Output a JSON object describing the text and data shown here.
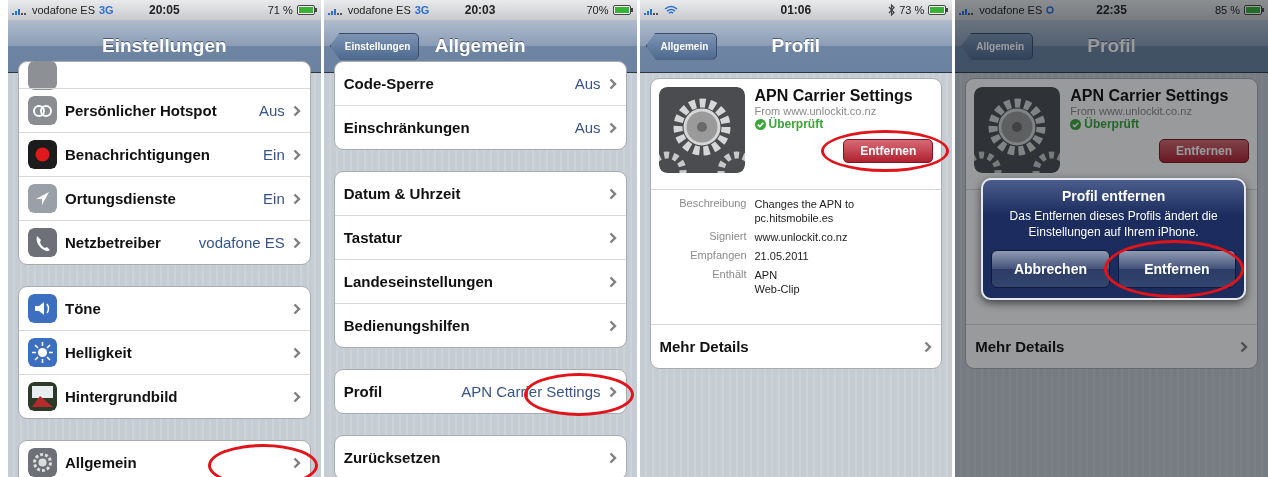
{
  "panels": [
    {
      "kind": "settings_list",
      "status_bar": {
        "carrier": "vodafone ES",
        "network": "3G",
        "time": "20:05",
        "battery": "71 %"
      },
      "nav_bar": {
        "title": "Einstellungen"
      },
      "groups": [
        {
          "cut_top": true,
          "rows": [
            {
              "kind": "partial"
            },
            {
              "kind": "icon_item",
              "label": "Persönlicher Hotspot",
              "value": "Aus"
            },
            {
              "kind": "icon_item",
              "label": "Benachrichtigungen",
              "value": "Ein"
            },
            {
              "kind": "icon_item",
              "label": "Ortungsdienste",
              "value": "Ein"
            },
            {
              "kind": "icon_item",
              "label": "Netzbetreiber",
              "value": "vodafone ES"
            }
          ]
        },
        {
          "rows": [
            {
              "kind": "icon_item",
              "label": "Töne"
            },
            {
              "kind": "icon_item",
              "label": "Helligkeit"
            },
            {
              "kind": "icon_item",
              "label": "Hintergrundbild"
            }
          ]
        },
        {
          "rows": [
            {
              "kind": "icon_item",
              "label": "Allgemein",
              "circled": true
            }
          ]
        }
      ]
    },
    {
      "kind": "settings_list",
      "status_bar": {
        "carrier": "vodafone ES",
        "network": "3G",
        "time": "20:03",
        "battery": "70%"
      },
      "nav_bar": {
        "back": "Einstellungen",
        "title": "Allgemein"
      },
      "groups": [
        {
          "cut_top": true,
          "rows": [
            {
              "kind": "item",
              "label": "Code-Sperre",
              "value": "Aus"
            },
            {
              "kind": "item",
              "label": "Einschränkungen",
              "value": "Aus"
            }
          ]
        },
        {
          "rows": [
            {
              "kind": "item",
              "label": "Datum & Uhrzeit"
            },
            {
              "kind": "item",
              "label": "Tastatur"
            },
            {
              "kind": "item",
              "label": "Landeseinstellungen"
            },
            {
              "kind": "item",
              "label": "Bedienungshilfen"
            }
          ]
        },
        {
          "rows": [
            {
              "kind": "item",
              "label": "Profil",
              "value": "APN Carrier Settings",
              "circled": true
            }
          ]
        },
        {
          "rows": [
            {
              "kind": "item",
              "label": "Zurücksetzen"
            }
          ]
        }
      ]
    },
    {
      "kind": "profile",
      "status_bar": {
        "time": "01:06",
        "battery": "73 %",
        "wifi": true,
        "bluetooth": true
      },
      "nav_bar": {
        "back": "Allgemein",
        "title": "Profil"
      },
      "profile": {
        "name": "APN Carrier Settings",
        "source": "From www.unlockit.co.nz",
        "verified": "Überprüft",
        "remove_button": {
          "label": "Entfernen",
          "circled": true
        },
        "details": [
          {
            "label": "Beschreibung",
            "lines": [
              "Changes the APN to",
              "pc.hitsmobile.es"
            ]
          },
          {
            "label": "Signiert",
            "lines": [
              "www.unlockit.co.nz"
            ]
          },
          {
            "label": "Empfangen",
            "lines": [
              "21.05.2011"
            ]
          },
          {
            "label": "Enthält",
            "lines": [
              "APN",
              "Web-Clip"
            ]
          }
        ],
        "more": "Mehr Details"
      }
    },
    {
      "kind": "profile",
      "dimmed": true,
      "status_bar": {
        "carrier": "vodafone ES",
        "time": "22:35",
        "battery": "85 %",
        "activity": true
      },
      "nav_bar": {
        "back": "Allgemein",
        "title": "Profil"
      },
      "profile": {
        "name": "APN Carrier Settings",
        "source": "From www.unlockit.co.nz",
        "verified": "Überprüft",
        "remove_button": {
          "label": "Entfernen"
        },
        "more": "Mehr Details"
      },
      "alert": {
        "title": "Profil entfernen",
        "message": "Das Entfernen dieses Profils ändert die Einstellungen auf Ihrem iPhone.",
        "buttons": [
          {
            "label": "Abbrechen"
          },
          {
            "label": "Entfernen",
            "circled": true
          }
        ]
      }
    }
  ]
}
